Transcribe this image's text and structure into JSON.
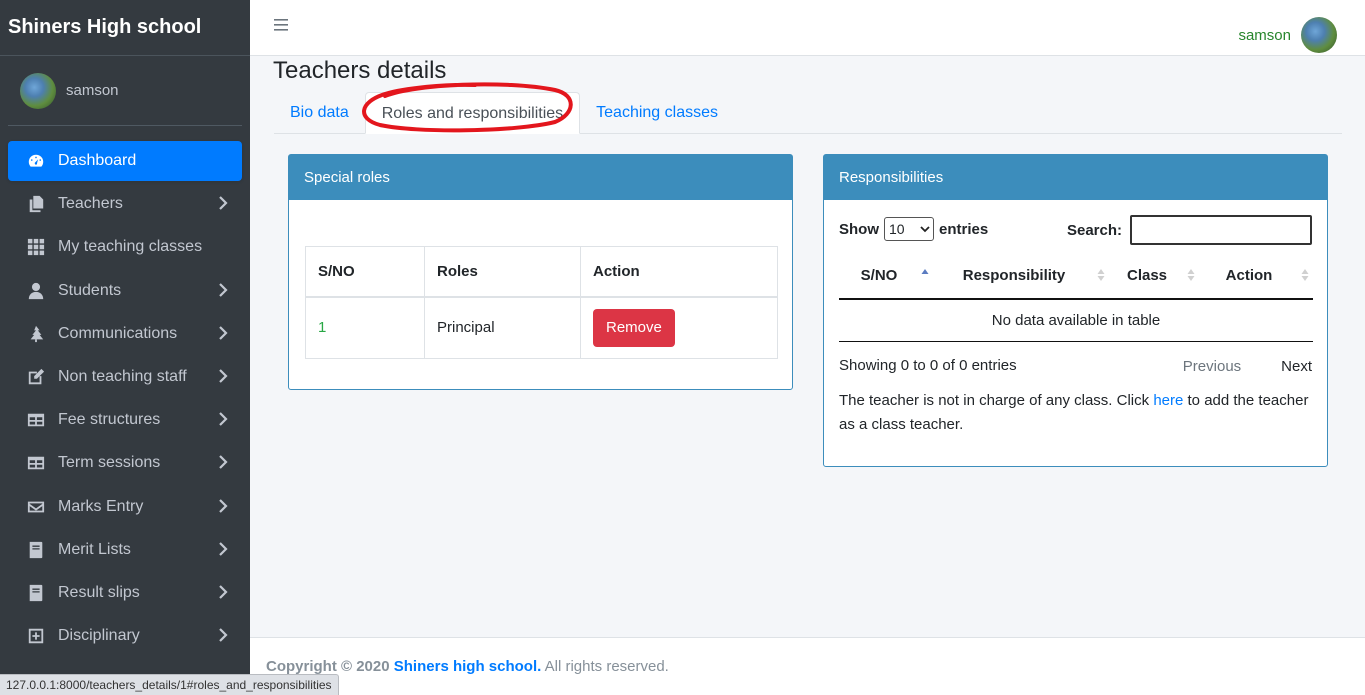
{
  "app": {
    "brand": "Shiners High school"
  },
  "sidebar": {
    "user_name": "samson",
    "items": [
      {
        "label": "Dashboard",
        "icon": "dashboard-icon",
        "active": true,
        "has_arrow": false
      },
      {
        "label": "Teachers",
        "icon": "copy-icon",
        "active": false,
        "has_arrow": true
      },
      {
        "label": "My teaching classes",
        "icon": "grid-icon",
        "active": false,
        "has_arrow": false
      },
      {
        "label": "Students",
        "icon": "user-icon",
        "active": false,
        "has_arrow": true
      },
      {
        "label": "Communications",
        "icon": "tree-icon",
        "active": false,
        "has_arrow": true
      },
      {
        "label": "Non teaching staff",
        "icon": "edit-icon",
        "active": false,
        "has_arrow": true
      },
      {
        "label": "Fee structures",
        "icon": "table-icon",
        "active": false,
        "has_arrow": true
      },
      {
        "label": "Term sessions",
        "icon": "table-icon",
        "active": false,
        "has_arrow": true
      },
      {
        "label": "Marks Entry",
        "icon": "envelope-icon",
        "active": false,
        "has_arrow": true
      },
      {
        "label": "Merit Lists",
        "icon": "book-icon",
        "active": false,
        "has_arrow": true
      },
      {
        "label": "Result slips",
        "icon": "book-icon",
        "active": false,
        "has_arrow": true
      },
      {
        "label": "Disciplinary",
        "icon": "plus-square-icon",
        "active": false,
        "has_arrow": true
      }
    ]
  },
  "topbar": {
    "user_name": "samson"
  },
  "page": {
    "title": "Teachers details",
    "tabs": [
      {
        "label": "Bio data",
        "active": false
      },
      {
        "label": "Roles and responsibilities",
        "active": true
      },
      {
        "label": "Teaching classes",
        "active": false
      }
    ]
  },
  "special_roles": {
    "title": "Special roles",
    "columns": [
      "S/NO",
      "Roles",
      "Action"
    ],
    "rows": [
      {
        "sn": "1",
        "role": "Principal",
        "action": "Remove"
      }
    ]
  },
  "responsibilities": {
    "title": "Responsibilities",
    "show_label": "Show",
    "entries_value": "10",
    "entries_label": "entries",
    "search_label": "Search:",
    "search_value": "",
    "columns": [
      "S/NO",
      "Responsibility",
      "Class",
      "Action"
    ],
    "empty_text": "No data available in table",
    "info": "Showing 0 to 0 of 0 entries",
    "previous": "Previous",
    "next": "Next",
    "note_before": "The teacher is not in charge of any class. Click ",
    "note_link": "here",
    "note_after": " to add the teacher as a class teacher."
  },
  "footer": {
    "copyright": "Copyright © 2020",
    "school": "Shiners high school.",
    "rights": "All rights reserved."
  },
  "status_bar": {
    "url": "127.0.0.1:8000/teachers_details/1#roles_and_responsibilities"
  },
  "colors": {
    "primary": "#007bff",
    "card_header": "#3c8dbc",
    "danger": "#dc3545",
    "sidebar": "#343a40",
    "annotation": "#e3161d"
  }
}
